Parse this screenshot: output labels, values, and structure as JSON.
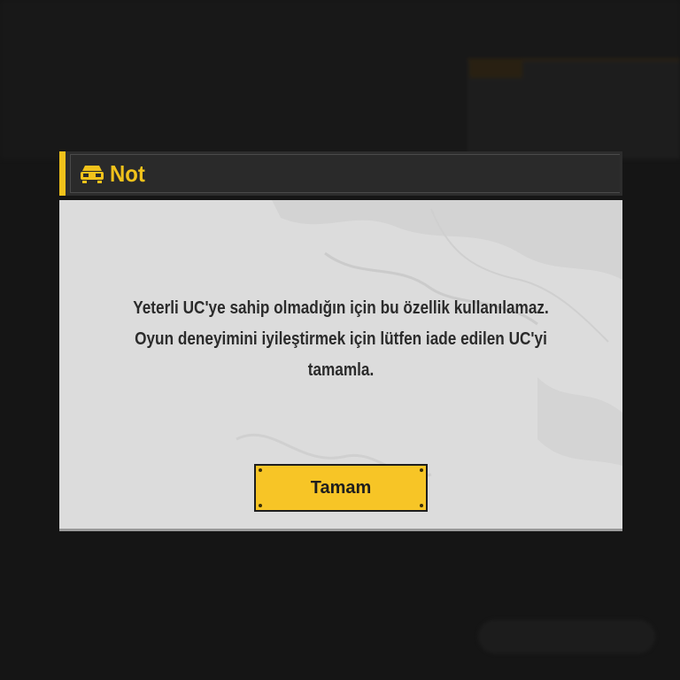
{
  "dialog": {
    "title": "Not",
    "icon": "vehicle-icon",
    "message": "Yeterli UC'ye sahip olmadığın için bu özellik kullanılamaz. Oyun deneyimini iyileştirmek için lütfen iade edilen UC'yi tamamla.",
    "ok_label": "Tamam"
  },
  "colors": {
    "accent": "#f1c21b",
    "button": "#f7c526",
    "body_bg": "#dcdcdc",
    "header_bg": "#2d2d2d",
    "overlay_bg": "#151515"
  }
}
